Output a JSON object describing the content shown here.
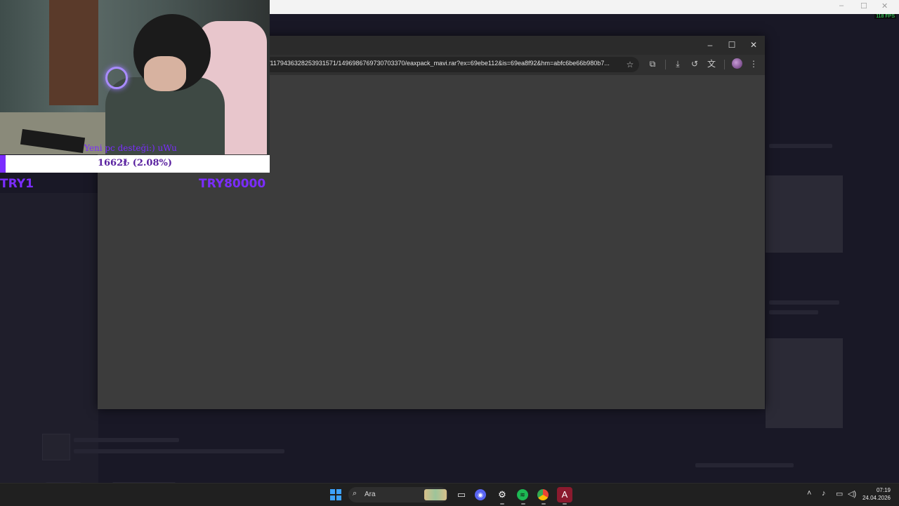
{
  "browser": {
    "url": "/1179436328253931571/1496986769730703370/eaxpack_mavi.rar?ex=69ebe112&is=69ea8f92&hm=abfc6be66b980b7...",
    "toolbar_icons": [
      "star-icon",
      "extensions-icon",
      "download-icon",
      "history-icon",
      "translate-icon",
      "profile-avatar",
      "menu-icon"
    ],
    "window_controls": {
      "minimize": "–",
      "maximize": "☐",
      "close": "✕"
    }
  },
  "overlay": {
    "cam_caption": "Yeni pc desteği:) uWu",
    "donation_text": "1662₺ (2.08%)",
    "donation_progress_percent": 2.08,
    "try_left": "TRY1",
    "try_right": "TRY80000",
    "accent_color": "#7b2cff"
  },
  "topbar": {
    "fps": "118 FPS"
  },
  "taskbar": {
    "search_label": "Ara",
    "apps": [
      "windows-start",
      "search",
      "file-explorer",
      "discord",
      "steam",
      "spotify",
      "chrome",
      "streaming-app"
    ],
    "time": "07:19",
    "date": "24.04.2026"
  }
}
